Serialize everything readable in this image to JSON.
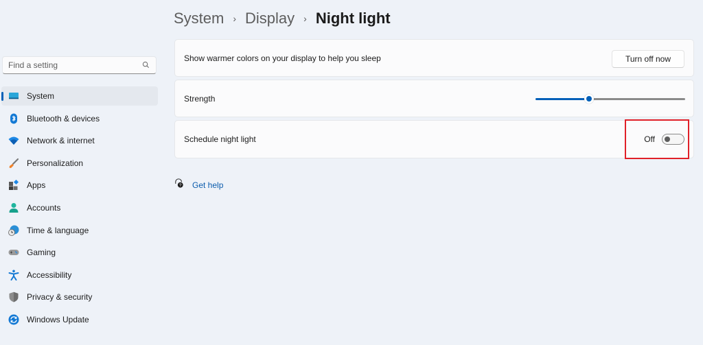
{
  "sidebar": {
    "search": {
      "placeholder": "Find a setting",
      "value": ""
    },
    "items": [
      {
        "label": "System",
        "icon": "system-icon",
        "active": true
      },
      {
        "label": "Bluetooth & devices",
        "icon": "bluetooth-icon"
      },
      {
        "label": "Network & internet",
        "icon": "wifi-icon"
      },
      {
        "label": "Personalization",
        "icon": "brush-icon"
      },
      {
        "label": "Apps",
        "icon": "apps-icon"
      },
      {
        "label": "Accounts",
        "icon": "account-icon"
      },
      {
        "label": "Time & language",
        "icon": "globe-clock-icon"
      },
      {
        "label": "Gaming",
        "icon": "gamepad-icon"
      },
      {
        "label": "Accessibility",
        "icon": "accessibility-icon"
      },
      {
        "label": "Privacy & security",
        "icon": "shield-icon"
      },
      {
        "label": "Windows Update",
        "icon": "update-icon"
      }
    ]
  },
  "breadcrumb": {
    "items": [
      "System",
      "Display"
    ],
    "current": "Night light",
    "separator": "›"
  },
  "cards": {
    "night_light": {
      "label": "Show warmer colors on your display to help you sleep",
      "button": "Turn off now"
    },
    "strength": {
      "label": "Strength",
      "value_percent": 36
    },
    "schedule": {
      "label": "Schedule night light",
      "state_label": "Off",
      "on": false
    }
  },
  "help": {
    "label": "Get help"
  },
  "colors": {
    "accent": "#005fb8",
    "highlight": "#e02028",
    "link": "#0b5cad"
  }
}
